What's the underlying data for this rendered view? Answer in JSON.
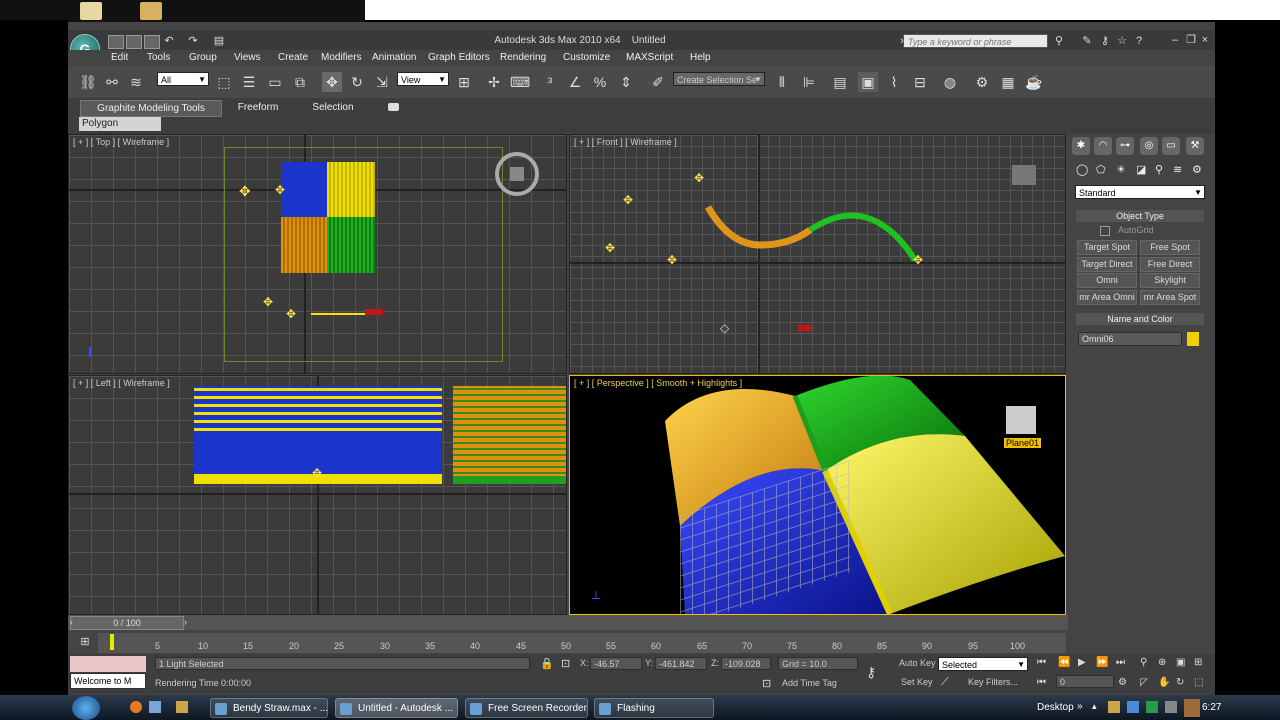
{
  "app": {
    "title": "Autodesk 3ds Max  2010 x64",
    "doc": "Untitled",
    "search_placeholder": "Type a keyword or phrase"
  },
  "menu": [
    "Edit",
    "Tools",
    "Group",
    "Views",
    "Create",
    "Modifiers",
    "Animation",
    "Graph Editors",
    "Rendering",
    "Customize",
    "MAXScript",
    "Help"
  ],
  "toolbar": {
    "filter": "All",
    "ref_coord": "View",
    "selection_set": "Create Selection Se"
  },
  "ribbon": {
    "tabs": [
      "Graphite Modeling Tools",
      "Freeform",
      "Selection"
    ],
    "panel": "Polygon Modeling"
  },
  "viewports": {
    "top": "[ + ] [ Top ] [ Wireframe ]",
    "front": "[ + ] [ Front ] [ Wireframe ]",
    "left": "[ + ] [ Left ] [ Wireframe ]",
    "perspective": "[ + ] [ Perspective ] [ Smooth + Highlights ]",
    "persp_object": "Plane01"
  },
  "command_panel": {
    "category": "Standard",
    "rollout_object_type": "Object Type",
    "autogrid": "AutoGrid",
    "buttons": [
      "Target Spot",
      "Free Spot",
      "Target Direct",
      "Free Direct",
      "Omni",
      "Skylight",
      "mr Area Omni",
      "mr Area Spot"
    ],
    "rollout_name_color": "Name and Color",
    "object_name": "Omni06",
    "object_color": "#f0d000"
  },
  "timeline": {
    "frame": "0 / 100",
    "ticks": [
      "5",
      "10",
      "15",
      "20",
      "25",
      "30",
      "35",
      "40",
      "45",
      "50",
      "55",
      "60",
      "65",
      "70",
      "75",
      "80",
      "85",
      "90",
      "95",
      "100"
    ]
  },
  "status": {
    "welcome": "Welcome to M",
    "selection": "1 Light Selected",
    "render_time": "Rendering Time  0:00:00",
    "x_label": "X:",
    "x": "-46.57",
    "y_label": "Y:",
    "y": "-461.842",
    "z_label": "Z:",
    "z": "-109.028",
    "grid": "Grid = 10.0",
    "add_time_tag": "Add Time Tag",
    "auto_key": "Auto Key",
    "set_key": "Set Key",
    "key_mode": "Selected",
    "key_filters": "Key Filters...",
    "frame_field": "0"
  },
  "taskbar": {
    "items": [
      "Bendy Straw.max - ...",
      "Untitled - Autodesk ...",
      "Free Screen Recorder",
      "Flashing"
    ],
    "desktop": "Desktop",
    "clock": "6:27"
  }
}
